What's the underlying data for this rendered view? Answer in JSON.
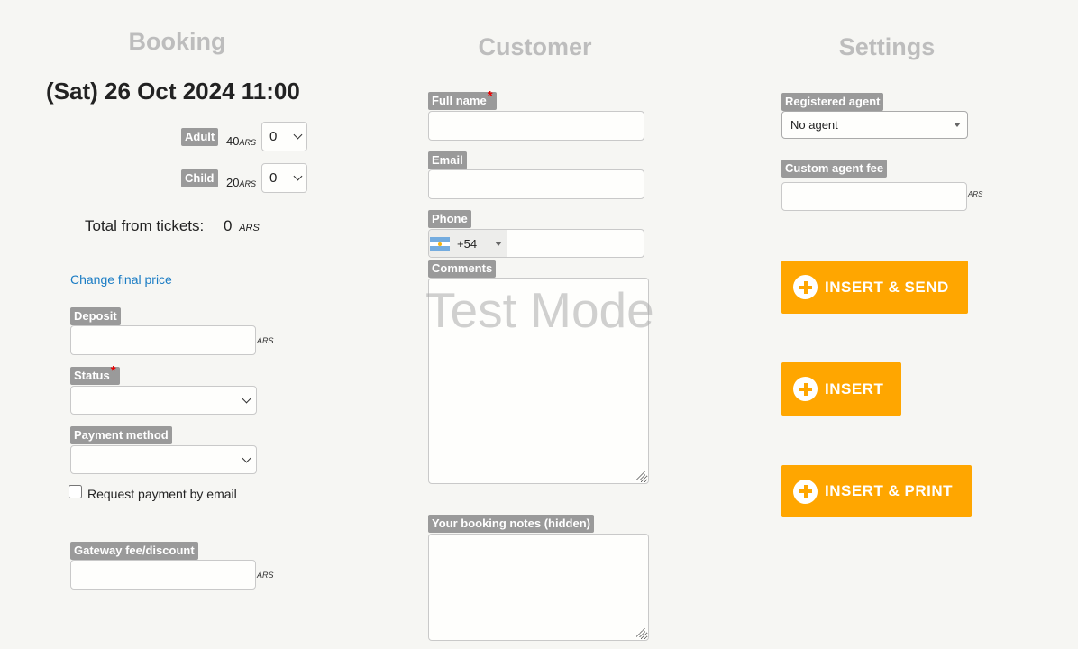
{
  "columns": {
    "booking": "Booking",
    "customer": "Customer",
    "settings": "Settings"
  },
  "booking": {
    "date_heading": "(Sat) 26 Oct 2024 11:00",
    "tickets": [
      {
        "label": "Adult",
        "price": "40",
        "currency": "ARS",
        "qty": "0"
      },
      {
        "label": "Child",
        "price": "20",
        "currency": "ARS",
        "qty": "0"
      }
    ],
    "total_label": "Total from tickets:",
    "total_value": "0",
    "total_currency": "ARS",
    "change_price_link": "Change final price",
    "deposit_label": "Deposit",
    "deposit_currency": "ARS",
    "deposit_value": "",
    "status_label": "Status",
    "status_value": "",
    "payment_method_label": "Payment method",
    "payment_method_value": "",
    "request_payment_label": "Request payment by email",
    "gateway_fee_label": "Gateway fee/discount",
    "gateway_fee_currency": "ARS",
    "gateway_fee_value": ""
  },
  "customer": {
    "full_name_label": "Full name",
    "full_name_value": "",
    "email_label": "Email",
    "email_value": "",
    "phone_label": "Phone",
    "phone_country_code": "+54",
    "phone_value": "",
    "comments_label": "Comments",
    "comments_value": "",
    "watermark": "Test Mode",
    "notes_label": "Your booking notes (hidden)",
    "notes_value": ""
  },
  "settings": {
    "agent_label": "Registered agent",
    "agent_value": "No agent",
    "agent_fee_label": "Custom agent fee",
    "agent_fee_currency": "ARS",
    "agent_fee_value": "",
    "buttons": {
      "insert_send": "INSERT & SEND",
      "insert": "INSERT",
      "insert_print": "INSERT & PRINT"
    }
  },
  "colors": {
    "accent": "#ffa600",
    "label_bg": "#9a9a9a",
    "link": "#1a7cc4",
    "heading_muted": "#bdbdbd"
  }
}
